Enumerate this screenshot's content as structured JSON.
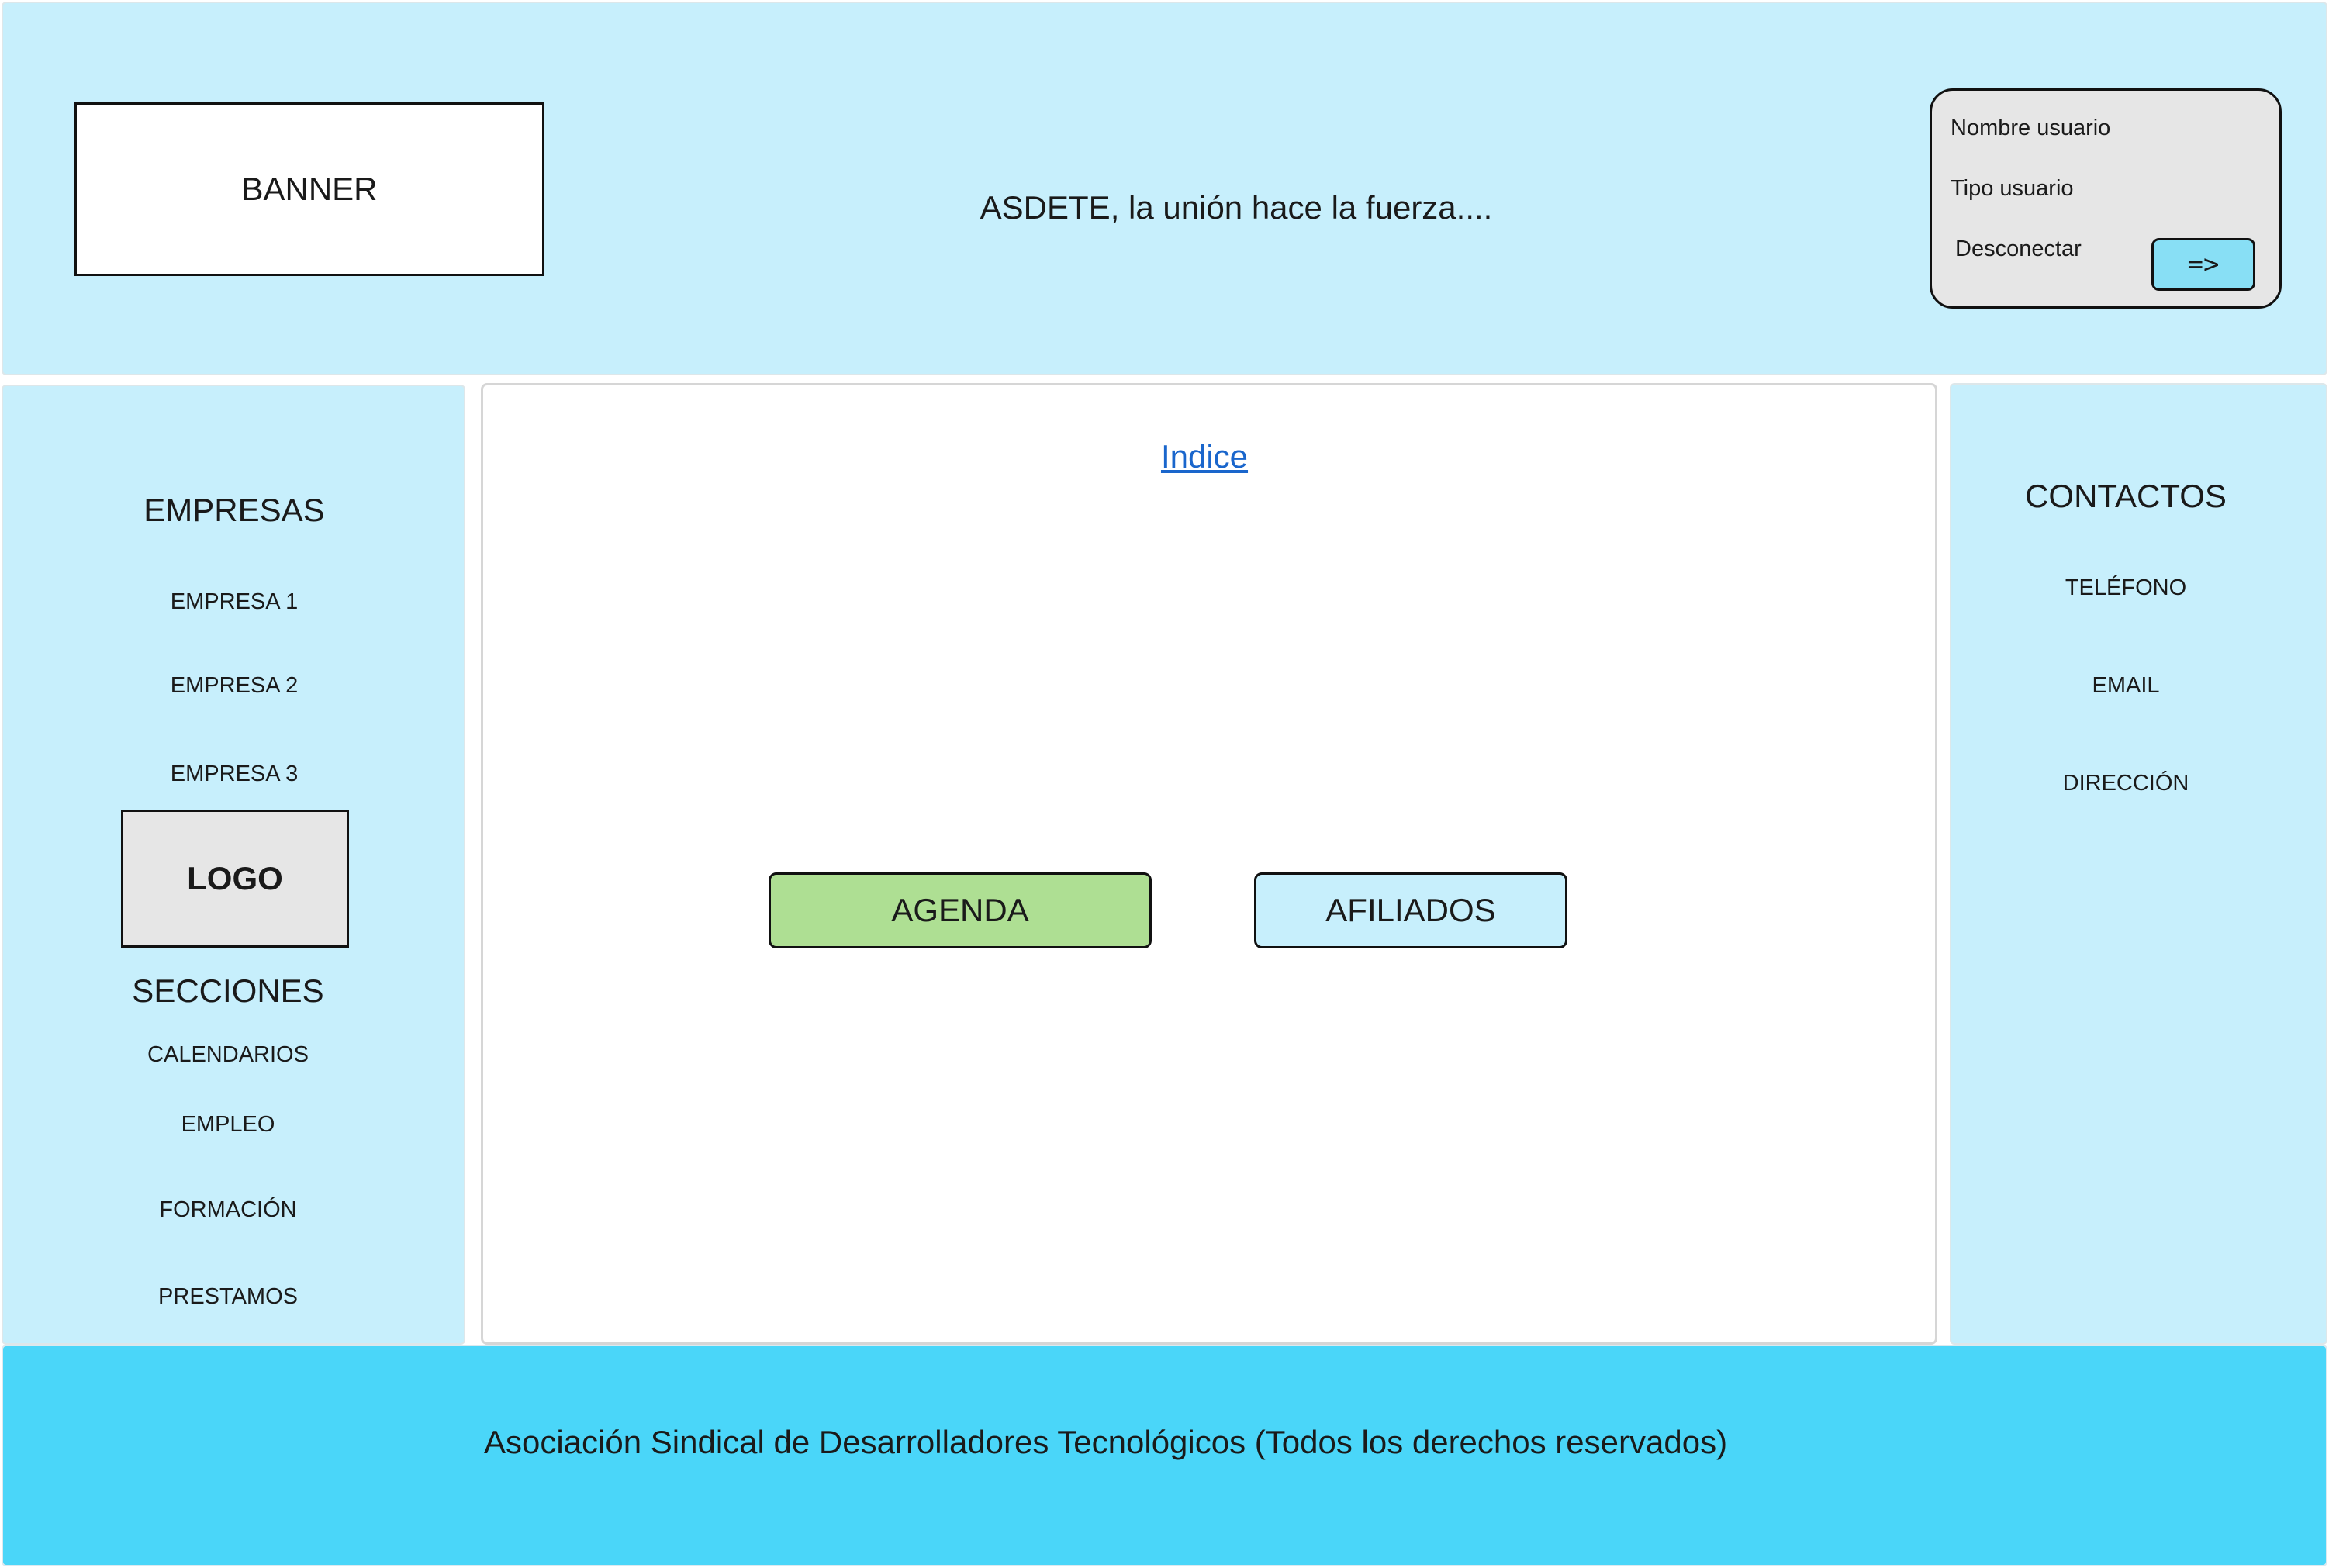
{
  "header": {
    "banner_label": "BANNER",
    "slogan": "ASDETE, la unión hace la fuerza....",
    "user_panel": {
      "username_label": "Nombre usuario",
      "user_type_label": "Tipo usuario",
      "disconnect_label": "Desconectar",
      "disconnect_button_label": "=>"
    }
  },
  "sidebar_left": {
    "companies_title": "EMPRESAS",
    "companies": [
      "EMPRESA 1",
      "EMPRESA 2",
      "EMPRESA 3"
    ],
    "logo_label": "LOGO",
    "sections_title": "SECCIONES",
    "sections": [
      "CALENDARIOS",
      "EMPLEO",
      "FORMACIÓN",
      "PRESTAMOS"
    ]
  },
  "main": {
    "index_link": "Indice",
    "buttons": {
      "agenda": "AGENDA",
      "afiliados": "AFILIADOS"
    }
  },
  "sidebar_right": {
    "contacts_title": "CONTACTOS",
    "contacts": [
      "TELÉFONO",
      "EMAIL",
      "DIRECCIÓN"
    ]
  },
  "footer": {
    "text": "Asociación Sindical de Desarrolladores Tecnológicos (Todos los derechos reservados)"
  },
  "colors": {
    "panel_bg": "#c7effc",
    "footer_bg": "#4ad6f9",
    "agenda_bg": "#aedf93",
    "logout_btn_bg": "#88dff5",
    "logo_bg": "#e6e6e6",
    "link": "#1a66cc"
  }
}
